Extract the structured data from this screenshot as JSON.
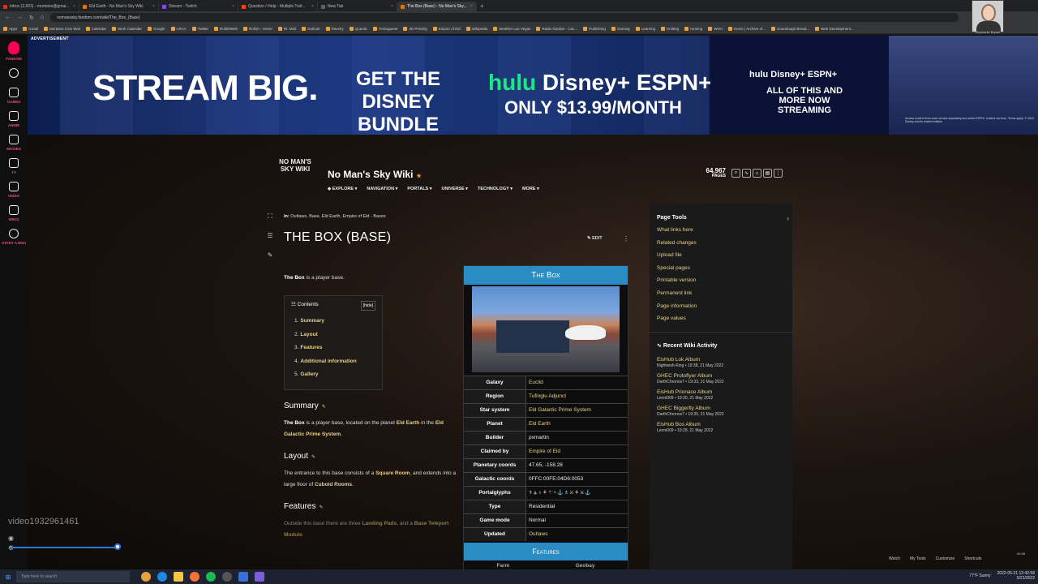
{
  "browser": {
    "tabs": [
      {
        "label": "Inbox (2,923) - mortaine@gmai...",
        "color": "#d93025"
      },
      {
        "label": "Eld Earth - No Man's Sky Wiki",
        "color": "#e8710a"
      },
      {
        "label": "Stream - Twitch",
        "color": "#9146ff"
      },
      {
        "label": "Question / Help - Multiple Twit...",
        "color": "#ff4500"
      },
      {
        "label": "New Tab",
        "color": "#5f6368"
      },
      {
        "label": "The Box (Base) - No Man's Sky...",
        "color": "#e8710a",
        "active": true
      }
    ],
    "url": "nomanssky.fandom.com/wiki/The_Box_(Base)",
    "bookmarks": [
      "Apps",
      "Gmail",
      "Mortaine.Com Mail",
      "Calendar",
      "Work Calendar",
      "Google",
      "USAA",
      "Twitter",
      "Roll20Web",
      "Roll20 - Home",
      "RI: Mail",
      "Outlook",
      "Ravelry",
      "Quantic",
      "Portuguese",
      "3D Printing",
      "Empire of Eld",
      "Wikipedia",
      "Weather Las Vegas",
      "Radio Garden - Cac...",
      "Publishing",
      "Gaming",
      "Learning",
      "Knitting",
      "running",
      "Wren",
      "Home | Archive of...",
      "Soundough Bread...",
      "Web Development..."
    ],
    "webcam_label": "Stephanie Bryant"
  },
  "fandom_rail": [
    {
      "label": "FANDOM"
    },
    {
      "label": ""
    },
    {
      "label": "GAMES"
    },
    {
      "label": "ANIME"
    },
    {
      "label": "MOVIES"
    },
    {
      "label": "TV"
    },
    {
      "label": "VIDEO"
    },
    {
      "label": "WIKIS"
    },
    {
      "label": "START A WIKI"
    }
  ],
  "ad": {
    "label": "ADVERTISEMENT",
    "headline": "STREAM BIG.",
    "bundle": "GET THE DISNEY BUNDLE",
    "brand_hulu": "hulu",
    "brand_disney": "Disney+",
    "brand_espn": "ESPN+",
    "price": "ONLY $13.99/MONTH",
    "right_brands": "hulu  Disney+  ESPN+",
    "right_stream": "ALL OF THIS AND MORE NOW STREAMING",
    "fine_print": "Access content from each service separately and select ESPN+ content via Hulu. Terms apply. © 2022 Disney and its related entities."
  },
  "wiki": {
    "logo_line1": "NO MAN'S",
    "logo_line2": "SKY WIKI",
    "title": "No Man's Sky Wiki",
    "nav": [
      "EXPLORE",
      "NAVIGATION",
      "PORTALS",
      "UNIVERSE",
      "TECHNOLOGY",
      "MORE"
    ],
    "pages_count": "64,967",
    "pages_label": "PAGES"
  },
  "article": {
    "breadcrumb_prefix": "in:",
    "breadcrumb": "Outlaws, Base, Eld Earth, Empire of Eld - Bases",
    "title": "THE BOX (BASE)",
    "edit_label": "EDIT",
    "intro_bold": "The Box",
    "intro_rest": " is a player base.",
    "toc_title": "Contents",
    "toc_hide": "[hide]",
    "toc": [
      {
        "n": "1.",
        "label": "Summary"
      },
      {
        "n": "2.",
        "label": "Layout"
      },
      {
        "n": "3.",
        "label": "Features"
      },
      {
        "n": "4.",
        "label": "Additional information"
      },
      {
        "n": "5.",
        "label": "Gallery"
      }
    ],
    "summary_h": "Summary",
    "summary_bold": "The Box",
    "summary_a": " is a player base, located on the planet ",
    "summary_planet": "Eld Earth",
    "summary_b": " in the ",
    "summary_system": "Eld Galactic Prime System",
    "summary_c": ".",
    "layout_h": "Layout",
    "layout_a": "The entrance to this base consists of a ",
    "layout_link1": "Square Room",
    "layout_b": ", and extends into a large floor of ",
    "layout_link2": "Cuboid Rooms",
    "layout_c": ".",
    "features_h": "Features",
    "features_a": "Outside this base there are three ",
    "features_link1": "Landing Pads",
    "features_b": ", and a ",
    "features_link2": "Base Teleport Module",
    "features_c": "."
  },
  "infobox": {
    "title": "The Box",
    "rows": [
      {
        "k": "Galaxy",
        "v": "Euclid",
        "link": true
      },
      {
        "k": "Region",
        "v": "Tufinglu Adjunct",
        "link": true
      },
      {
        "k": "Star system",
        "v": "Eld Galactic Prime System",
        "link": true
      },
      {
        "k": "Planet",
        "v": "Eld Earth",
        "link": true
      },
      {
        "k": "Builder",
        "v": "pxmartin",
        "link": false
      },
      {
        "k": "Claimed by",
        "v": "Empire of Eld",
        "link": true
      },
      {
        "k": "Planetary coords",
        "v": "47.65, -158.28",
        "link": false
      },
      {
        "k": "Galactic coords",
        "v": "0FFC:00FE:04D6:0053",
        "link": false
      },
      {
        "k": "Portalglyphs",
        "v": "☥⚶♁⚘⚚♆⚓♗⚔⚘⚔⚓",
        "link": false,
        "glyph": true
      },
      {
        "k": "Type",
        "v": "Residential",
        "link": false
      },
      {
        "k": "Game mode",
        "v": "Normal",
        "link": false
      },
      {
        "k": "Updated",
        "v": "Outlaws",
        "link": true
      }
    ],
    "features_title": "Features",
    "features_row": [
      "Farm",
      "Geobay"
    ]
  },
  "sidebar": {
    "page_tools": "Page Tools",
    "links": [
      "What links here",
      "Related changes",
      "Upload file",
      "Special pages",
      "Printable version",
      "Permanent link",
      "Page information",
      "Page values"
    ],
    "rwa_title": "Recent Wiki Activity",
    "activity": [
      {
        "t": "EisHub Lok Album",
        "m": "Nightwish-King • 19:38, 21 May 2022"
      },
      {
        "t": "GHEC Protoflyer Album",
        "m": "DarthChronos7 • 19:33, 21 May 2022"
      },
      {
        "t": "EisHub Prionace Album",
        "m": "Lenni009 • 19:30, 21 May 2022"
      },
      {
        "t": "GHEC Biggerfly Album",
        "m": "DarthChronos7 • 19:30, 21 May 2022"
      },
      {
        "t": "EisHub Bos Album",
        "m": "Lenni009 • 19:28, 21 May 2022"
      }
    ]
  },
  "overlay": {
    "video_id": "video1932961461",
    "bottom_links": [
      "Watch",
      "My Tools",
      "Customize",
      "Shortcuts"
    ],
    "time_small": "00:48"
  },
  "taskbar": {
    "search_placeholder": "Type here to search",
    "weather": "77°F Sunny",
    "clock": "2022-05-21 12:42:58",
    "date": "5/21/2022"
  }
}
